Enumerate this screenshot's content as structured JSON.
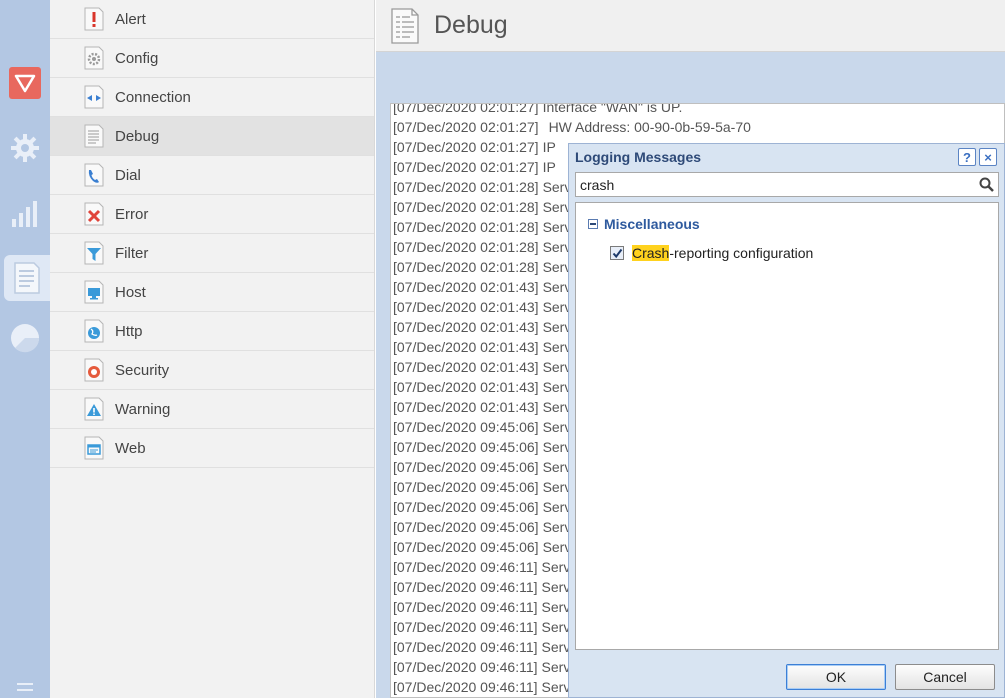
{
  "categories": [
    {
      "label": "Alert",
      "icon": "alert-icon",
      "selected": false
    },
    {
      "label": "Config",
      "icon": "config-icon",
      "selected": false
    },
    {
      "label": "Connection",
      "icon": "connection-icon",
      "selected": false
    },
    {
      "label": "Debug",
      "icon": "debug-icon",
      "selected": true
    },
    {
      "label": "Dial",
      "icon": "dial-icon",
      "selected": false
    },
    {
      "label": "Error",
      "icon": "error-icon",
      "selected": false
    },
    {
      "label": "Filter",
      "icon": "filter-icon",
      "selected": false
    },
    {
      "label": "Host",
      "icon": "host-icon",
      "selected": false
    },
    {
      "label": "Http",
      "icon": "http-icon",
      "selected": false
    },
    {
      "label": "Security",
      "icon": "security-icon",
      "selected": false
    },
    {
      "label": "Warning",
      "icon": "warning-icon",
      "selected": false
    },
    {
      "label": "Web",
      "icon": "web-icon",
      "selected": false
    }
  ],
  "header": {
    "title": "Debug"
  },
  "log": {
    "lines": [
      {
        "time": "[07/Dec/2020 02:01:27]",
        "text": "Interface \"WAN\" is UP."
      },
      {
        "time": "[07/Dec/2020 02:01:27]",
        "text": "HW Address: 00-90-0b-59-5a-70"
      },
      {
        "time": "[07/Dec/2020 02:01:27]",
        "text": "IP"
      },
      {
        "time": "[07/Dec/2020 02:01:27]",
        "text": "IP"
      },
      {
        "time": "[07/Dec/2020 02:01:28]",
        "text": "Serv"
      },
      {
        "time": "[07/Dec/2020 02:01:28]",
        "text": "Serv"
      },
      {
        "time": "[07/Dec/2020 02:01:28]",
        "text": "Serv"
      },
      {
        "time": "[07/Dec/2020 02:01:28]",
        "text": "Serv"
      },
      {
        "time": "[07/Dec/2020 02:01:28]",
        "text": "Serv"
      },
      {
        "time": "[07/Dec/2020 02:01:43]",
        "text": "Serv"
      },
      {
        "time": "[07/Dec/2020 02:01:43]",
        "text": "Serv"
      },
      {
        "time": "[07/Dec/2020 02:01:43]",
        "text": "Serv"
      },
      {
        "time": "[07/Dec/2020 02:01:43]",
        "text": "Serv"
      },
      {
        "time": "[07/Dec/2020 02:01:43]",
        "text": "Serv"
      },
      {
        "time": "[07/Dec/2020 02:01:43]",
        "text": "Serv"
      },
      {
        "time": "[07/Dec/2020 02:01:43]",
        "text": "Serv"
      },
      {
        "time": "[07/Dec/2020 09:45:06]",
        "text": "Serv"
      },
      {
        "time": "[07/Dec/2020 09:45:06]",
        "text": "Serv"
      },
      {
        "time": "[07/Dec/2020 09:45:06]",
        "text": "Serv"
      },
      {
        "time": "[07/Dec/2020 09:45:06]",
        "text": "Serv"
      },
      {
        "time": "[07/Dec/2020 09:45:06]",
        "text": "Serv"
      },
      {
        "time": "[07/Dec/2020 09:45:06]",
        "text": "Serv"
      },
      {
        "time": "[07/Dec/2020 09:45:06]",
        "text": "Serv"
      },
      {
        "time": "[07/Dec/2020 09:46:11]",
        "text": "Serv"
      },
      {
        "time": "[07/Dec/2020 09:46:11]",
        "text": "Serv"
      },
      {
        "time": "[07/Dec/2020 09:46:11]",
        "text": "Serv"
      },
      {
        "time": "[07/Dec/2020 09:46:11]",
        "text": "Serv"
      },
      {
        "time": "[07/Dec/2020 09:46:11]",
        "text": "Serv"
      },
      {
        "time": "[07/Dec/2020 09:46:11]",
        "text": "Serv"
      },
      {
        "time": "[07/Dec/2020 09:46:11]",
        "text": "Serv"
      }
    ]
  },
  "dialog": {
    "title": "Logging Messages",
    "help_label": "?",
    "close_label": "×",
    "search_value": "crash",
    "group_label": "Miscellaneous",
    "item_highlight": "Crash",
    "item_rest": "-reporting configuration",
    "item_checked": true,
    "ok_label": "OK",
    "cancel_label": "Cancel"
  },
  "colors": {
    "rail_bg": "#b3c7e3",
    "main_bg": "#c9d8eb",
    "highlight": "#ffd21e",
    "accent_red": "#e8685e"
  }
}
